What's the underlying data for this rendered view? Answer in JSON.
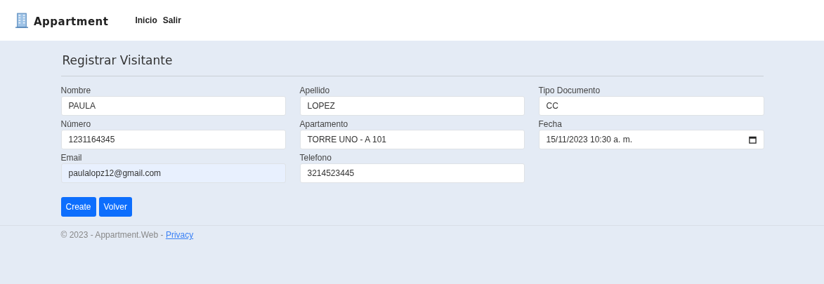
{
  "navbar": {
    "brand": "Appartment",
    "links": [
      {
        "label": "Inicio"
      },
      {
        "label": "Salir"
      }
    ]
  },
  "form": {
    "title": "Registrar Visitante",
    "fields": [
      {
        "label": "Nombre",
        "value": "PAULA",
        "kind": "text",
        "autofilled": false
      },
      {
        "label": "Apellido",
        "value": "LOPEZ",
        "kind": "text",
        "autofilled": false
      },
      {
        "label": "Tipo Documento",
        "value": "CC",
        "kind": "text",
        "autofilled": false
      },
      {
        "label": "Número",
        "value": "1231164345",
        "kind": "text",
        "autofilled": false
      },
      {
        "label": "Apartamento",
        "value": "TORRE UNO - A 101",
        "kind": "text",
        "autofilled": false
      },
      {
        "label": "Fecha",
        "value": "15/11/2023 10:30 a. m.",
        "kind": "date",
        "autofilled": false
      },
      {
        "label": "Email",
        "value": "paulalopz12@gmail.com",
        "kind": "text",
        "autofilled": true
      },
      {
        "label": "Telefono",
        "value": "3214523445",
        "kind": "text",
        "autofilled": false
      }
    ],
    "buttons": [
      {
        "label": "Create"
      },
      {
        "label": "Volver"
      }
    ]
  },
  "footer": {
    "text": "© 2023 - Appartment.Web - ",
    "link": "Privacy"
  }
}
